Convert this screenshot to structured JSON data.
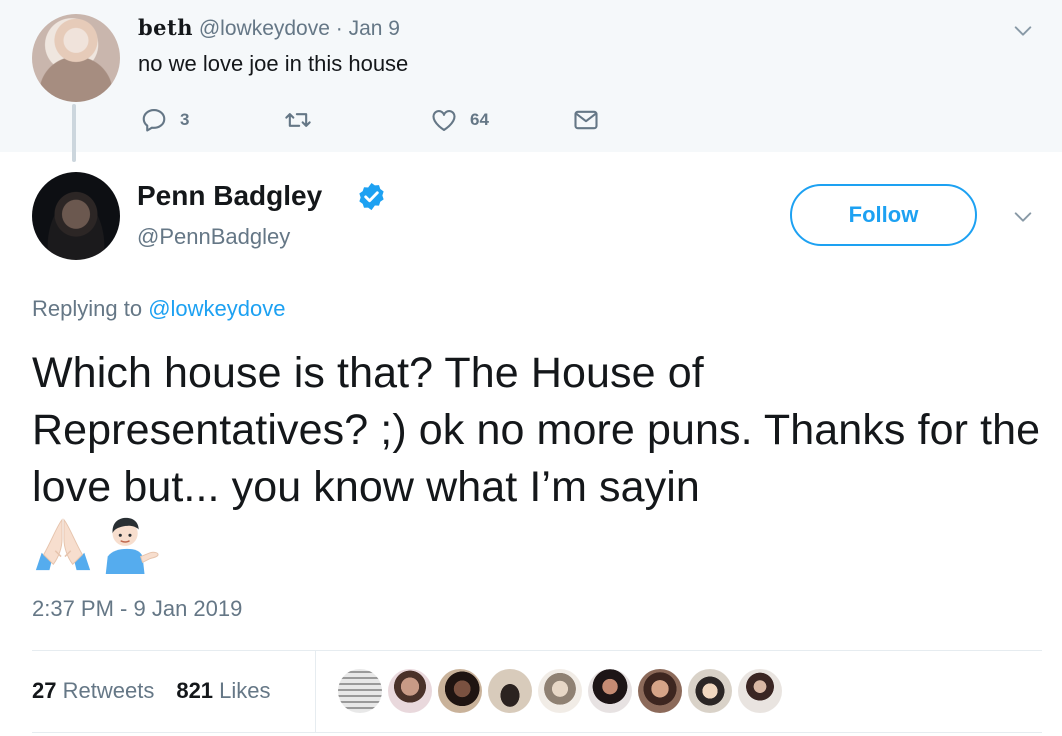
{
  "parent_tweet": {
    "display_name": "beth",
    "handle": "@lowkeydove",
    "separator": "·",
    "date": "Jan 9",
    "text": "no we love joe in this house",
    "actions": {
      "reply_icon": "reply-icon",
      "reply_count": "3",
      "retweet_icon": "retweet-icon",
      "like_icon": "heart-icon",
      "like_count": "64",
      "dm_icon": "envelope-icon"
    }
  },
  "main_tweet": {
    "display_name": "Penn Badgley",
    "verified_icon": "verified-badge-icon",
    "handle": "@PennBadgley",
    "follow_label": "Follow",
    "replying_prefix": "Replying to",
    "replying_mention": "@lowkeydove",
    "text": "Which house is that? The House of Representatives? ;) ok no more puns. Thanks for the love but... you know what I’m sayin",
    "emojis": [
      "folded-hands-emoji",
      "person-tipping-hand-emoji"
    ],
    "timestamp": "2:37 PM - 9 Jan 2019",
    "stats": {
      "retweets_count": "27",
      "retweets_label": "Retweets",
      "likes_count": "821",
      "likes_label": "Likes"
    },
    "liker_avatar_count": 9
  },
  "colors": {
    "accent": "#1da1f2",
    "secondary_text": "#657786",
    "primary_text": "#14171a",
    "parent_background": "#f5f8fa",
    "divider": "#e6ecf0"
  }
}
